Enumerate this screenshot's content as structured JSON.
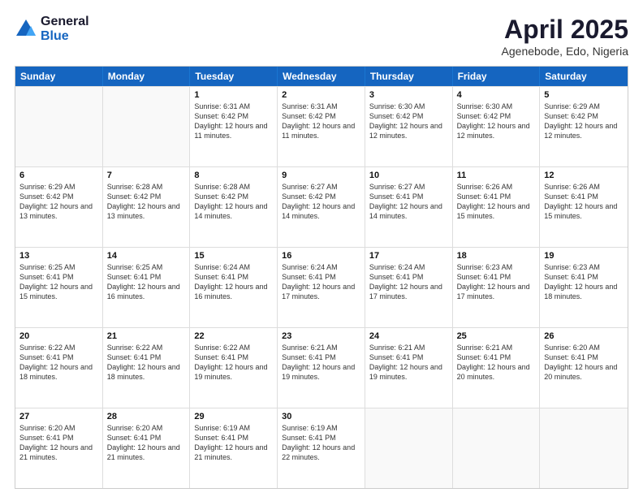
{
  "logo": {
    "general": "General",
    "blue": "Blue"
  },
  "title": "April 2025",
  "subtitle": "Agenebode, Edo, Nigeria",
  "headers": [
    "Sunday",
    "Monday",
    "Tuesday",
    "Wednesday",
    "Thursday",
    "Friday",
    "Saturday"
  ],
  "rows": [
    [
      {
        "day": "",
        "info": ""
      },
      {
        "day": "",
        "info": ""
      },
      {
        "day": "1",
        "info": "Sunrise: 6:31 AM\nSunset: 6:42 PM\nDaylight: 12 hours and 11 minutes."
      },
      {
        "day": "2",
        "info": "Sunrise: 6:31 AM\nSunset: 6:42 PM\nDaylight: 12 hours and 11 minutes."
      },
      {
        "day": "3",
        "info": "Sunrise: 6:30 AM\nSunset: 6:42 PM\nDaylight: 12 hours and 12 minutes."
      },
      {
        "day": "4",
        "info": "Sunrise: 6:30 AM\nSunset: 6:42 PM\nDaylight: 12 hours and 12 minutes."
      },
      {
        "day": "5",
        "info": "Sunrise: 6:29 AM\nSunset: 6:42 PM\nDaylight: 12 hours and 12 minutes."
      }
    ],
    [
      {
        "day": "6",
        "info": "Sunrise: 6:29 AM\nSunset: 6:42 PM\nDaylight: 12 hours and 13 minutes."
      },
      {
        "day": "7",
        "info": "Sunrise: 6:28 AM\nSunset: 6:42 PM\nDaylight: 12 hours and 13 minutes."
      },
      {
        "day": "8",
        "info": "Sunrise: 6:28 AM\nSunset: 6:42 PM\nDaylight: 12 hours and 14 minutes."
      },
      {
        "day": "9",
        "info": "Sunrise: 6:27 AM\nSunset: 6:42 PM\nDaylight: 12 hours and 14 minutes."
      },
      {
        "day": "10",
        "info": "Sunrise: 6:27 AM\nSunset: 6:41 PM\nDaylight: 12 hours and 14 minutes."
      },
      {
        "day": "11",
        "info": "Sunrise: 6:26 AM\nSunset: 6:41 PM\nDaylight: 12 hours and 15 minutes."
      },
      {
        "day": "12",
        "info": "Sunrise: 6:26 AM\nSunset: 6:41 PM\nDaylight: 12 hours and 15 minutes."
      }
    ],
    [
      {
        "day": "13",
        "info": "Sunrise: 6:25 AM\nSunset: 6:41 PM\nDaylight: 12 hours and 15 minutes."
      },
      {
        "day": "14",
        "info": "Sunrise: 6:25 AM\nSunset: 6:41 PM\nDaylight: 12 hours and 16 minutes."
      },
      {
        "day": "15",
        "info": "Sunrise: 6:24 AM\nSunset: 6:41 PM\nDaylight: 12 hours and 16 minutes."
      },
      {
        "day": "16",
        "info": "Sunrise: 6:24 AM\nSunset: 6:41 PM\nDaylight: 12 hours and 17 minutes."
      },
      {
        "day": "17",
        "info": "Sunrise: 6:24 AM\nSunset: 6:41 PM\nDaylight: 12 hours and 17 minutes."
      },
      {
        "day": "18",
        "info": "Sunrise: 6:23 AM\nSunset: 6:41 PM\nDaylight: 12 hours and 17 minutes."
      },
      {
        "day": "19",
        "info": "Sunrise: 6:23 AM\nSunset: 6:41 PM\nDaylight: 12 hours and 18 minutes."
      }
    ],
    [
      {
        "day": "20",
        "info": "Sunrise: 6:22 AM\nSunset: 6:41 PM\nDaylight: 12 hours and 18 minutes."
      },
      {
        "day": "21",
        "info": "Sunrise: 6:22 AM\nSunset: 6:41 PM\nDaylight: 12 hours and 18 minutes."
      },
      {
        "day": "22",
        "info": "Sunrise: 6:22 AM\nSunset: 6:41 PM\nDaylight: 12 hours and 19 minutes."
      },
      {
        "day": "23",
        "info": "Sunrise: 6:21 AM\nSunset: 6:41 PM\nDaylight: 12 hours and 19 minutes."
      },
      {
        "day": "24",
        "info": "Sunrise: 6:21 AM\nSunset: 6:41 PM\nDaylight: 12 hours and 19 minutes."
      },
      {
        "day": "25",
        "info": "Sunrise: 6:21 AM\nSunset: 6:41 PM\nDaylight: 12 hours and 20 minutes."
      },
      {
        "day": "26",
        "info": "Sunrise: 6:20 AM\nSunset: 6:41 PM\nDaylight: 12 hours and 20 minutes."
      }
    ],
    [
      {
        "day": "27",
        "info": "Sunrise: 6:20 AM\nSunset: 6:41 PM\nDaylight: 12 hours and 21 minutes."
      },
      {
        "day": "28",
        "info": "Sunrise: 6:20 AM\nSunset: 6:41 PM\nDaylight: 12 hours and 21 minutes."
      },
      {
        "day": "29",
        "info": "Sunrise: 6:19 AM\nSunset: 6:41 PM\nDaylight: 12 hours and 21 minutes."
      },
      {
        "day": "30",
        "info": "Sunrise: 6:19 AM\nSunset: 6:41 PM\nDaylight: 12 hours and 22 minutes."
      },
      {
        "day": "",
        "info": ""
      },
      {
        "day": "",
        "info": ""
      },
      {
        "day": "",
        "info": ""
      }
    ]
  ]
}
